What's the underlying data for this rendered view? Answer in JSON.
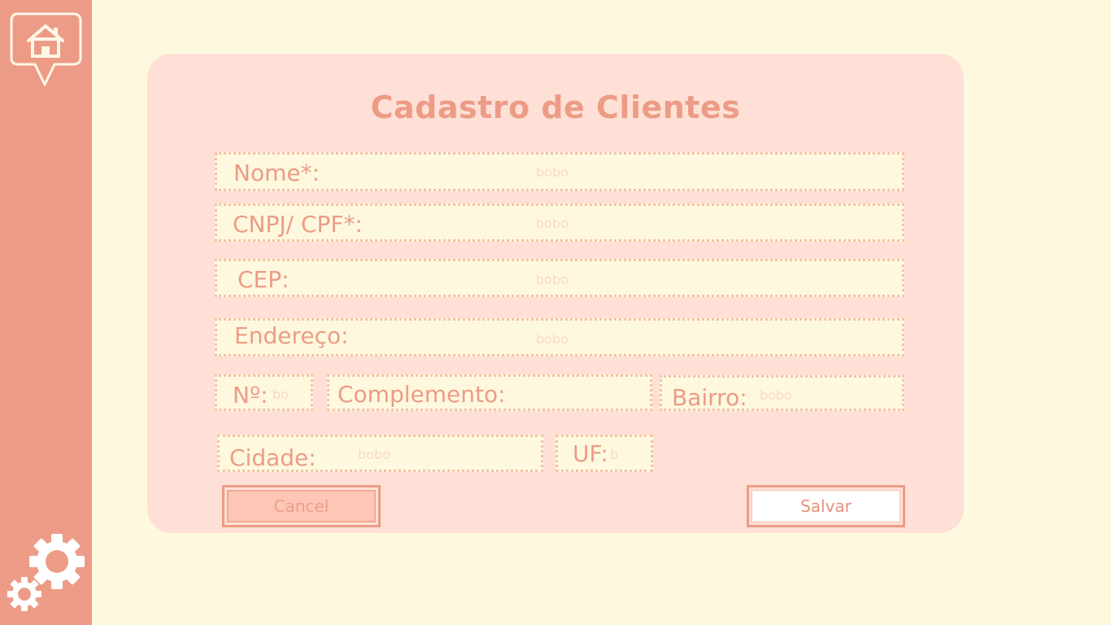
{
  "form": {
    "title": "Cadastro de Clientes",
    "fields": {
      "nome": {
        "label": "Nome*:",
        "placeholder": "bobo"
      },
      "cnpj_cpf": {
        "label": "CNPJ/ CPF*:",
        "placeholder": "bobo"
      },
      "cep": {
        "label": "CEP:",
        "placeholder": "bobo"
      },
      "endereco": {
        "label": "Endereço:",
        "placeholder": "bobo"
      },
      "numero": {
        "label": "Nº:",
        "placeholder": "bo"
      },
      "complemento": {
        "label": "Complemento:",
        "placeholder": ""
      },
      "bairro": {
        "label": "Bairro:",
        "placeholder": "bobo"
      },
      "cidade": {
        "label": "Cidade:",
        "placeholder": "bobo"
      },
      "uf": {
        "label": "UF:",
        "placeholder": "b"
      }
    },
    "buttons": {
      "cancel": "Cancel",
      "save": "Salvar"
    }
  },
  "icons": {
    "home": "home-icon",
    "settings": "gear-icon"
  },
  "colors": {
    "background": "#fef8df",
    "sidebar": "#ec9c86",
    "card": "#fee0d6",
    "accent": "#ec9c86"
  }
}
